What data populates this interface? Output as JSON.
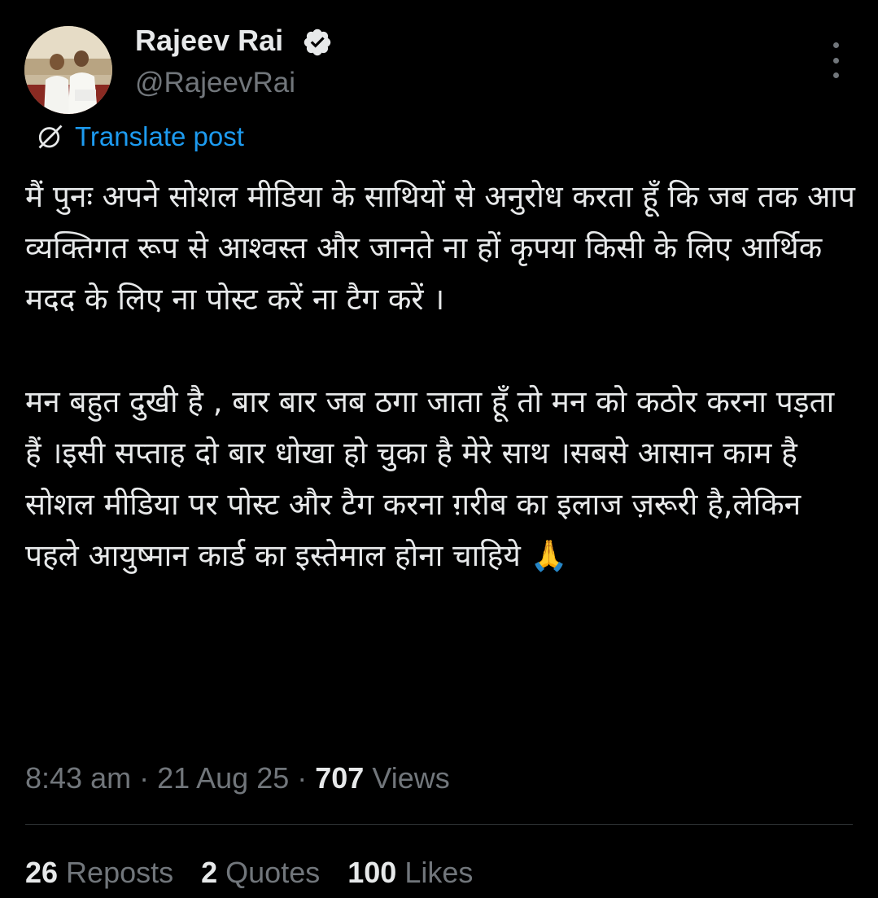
{
  "author": {
    "display_name": "Rajeev Rai",
    "handle": "@RajeevRai",
    "verified": true
  },
  "translate": {
    "label": "Translate post"
  },
  "post": {
    "paragraph_1": "मैं पुनः अपने सोशल मीडिया के साथियों से अनुरोध करता हूँ कि जब तक आप व्यक्तिगत रूप से आश्वस्त और जानते ना हों कृपया किसी के लिए आर्थिक मदद के लिए ना पोस्ट करें ना टैग करें ।",
    "paragraph_2": "मन बहुत दुखी है , बार बार जब ठगा जाता हूँ तो मन को कठोर करना पड़ता हैं ।इसी सप्ताह दो बार धोखा हो चुका है मेरे साथ ।सबसे आसान काम है सोशल मीडिया पर पोस्ट और टैग करना ग़रीब का इलाज ज़रूरी है,लेकिन पहले आयुष्मान कार्ड का इस्तेमाल होना चाहिये 🙏"
  },
  "meta": {
    "time": "8:43 am",
    "separator": " · ",
    "date": "21 Aug 25",
    "views_count": "707",
    "views_label": " Views"
  },
  "stats": {
    "reposts_count": "26",
    "reposts_label": " Reposts",
    "quotes_count": "2",
    "quotes_label": " Quotes",
    "likes_count": "100",
    "likes_label": " Likes"
  },
  "colors": {
    "background": "#000000",
    "text": "#e7e9ea",
    "secondary_text": "#71767b",
    "link": "#1d9bf0",
    "verified_badge": "#e7e9ea",
    "divider": "#2f3336"
  },
  "icons": {
    "verified": "verified-badge-icon",
    "translate": "translate-globe-icon",
    "more": "more-options-icon"
  }
}
